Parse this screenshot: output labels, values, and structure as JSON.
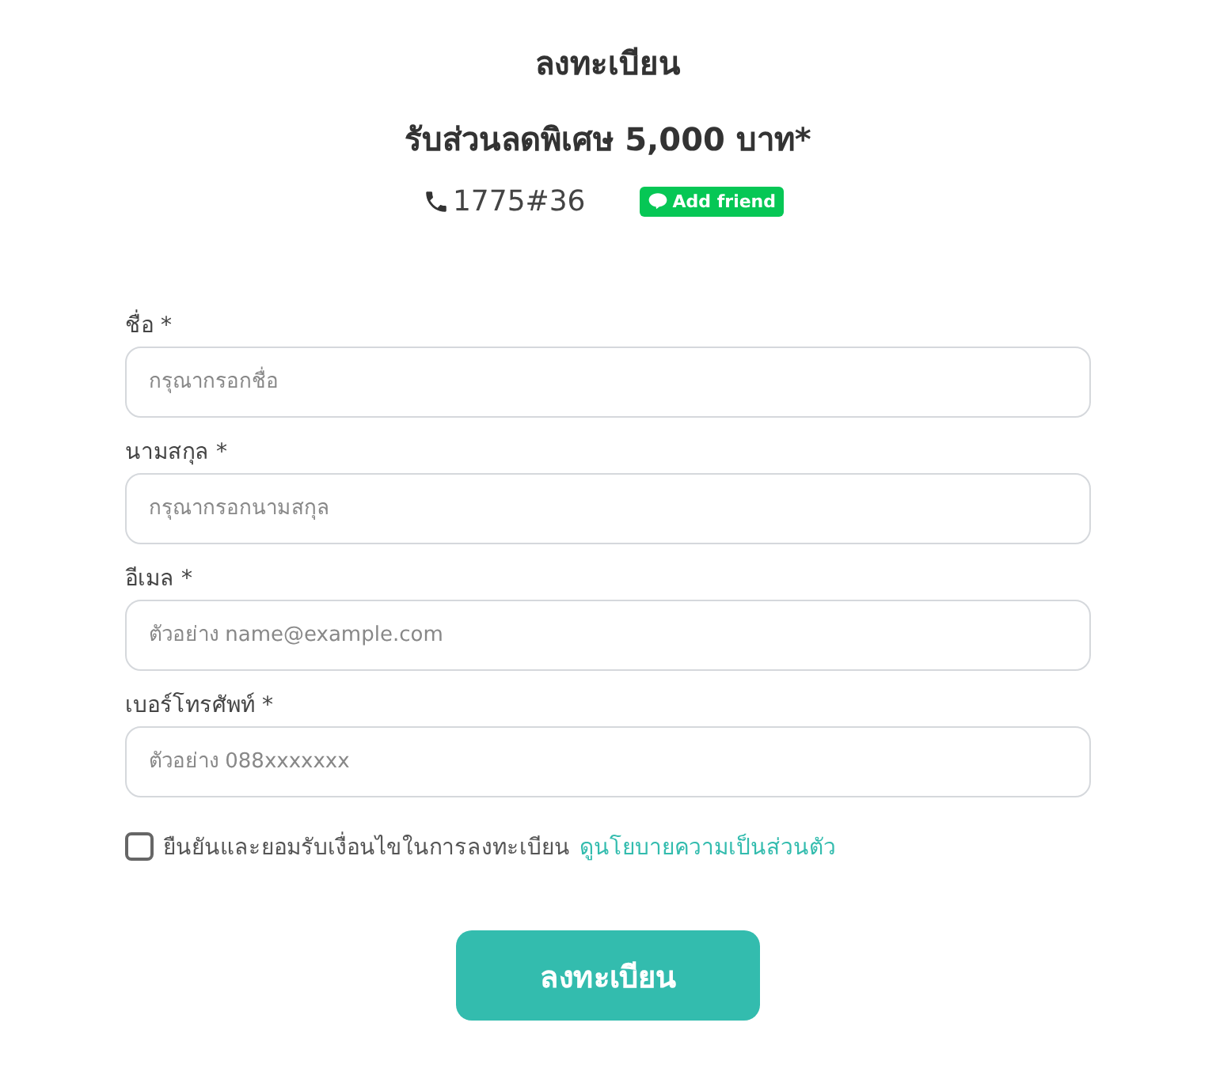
{
  "title": "ลงทะเบียน",
  "subtitle": "รับส่วนลดพิเศษ 5,000 บาท*",
  "phone": "1775#36",
  "line_button": "Add friend",
  "fields": [
    {
      "label": "ชื่อ *",
      "placeholder": "กรุณากรอกชื่อ"
    },
    {
      "label": "นามสกุล *",
      "placeholder": "กรุณากรอกนามสกุล"
    },
    {
      "label": "อีเมล *",
      "placeholder": "ตัวอย่าง name@example.com"
    },
    {
      "label": "เบอร์โทรศัพท์ *",
      "placeholder": "ตัวอย่าง 088xxxxxxx"
    }
  ],
  "consent": {
    "checked": false,
    "text": "ยืนยันและยอมรับเงื่อนไขในการลงทะเบียน",
    "link": "ดูนโยบายความเป็นส่วนตัว"
  },
  "submit": "ลงทะเบียน"
}
